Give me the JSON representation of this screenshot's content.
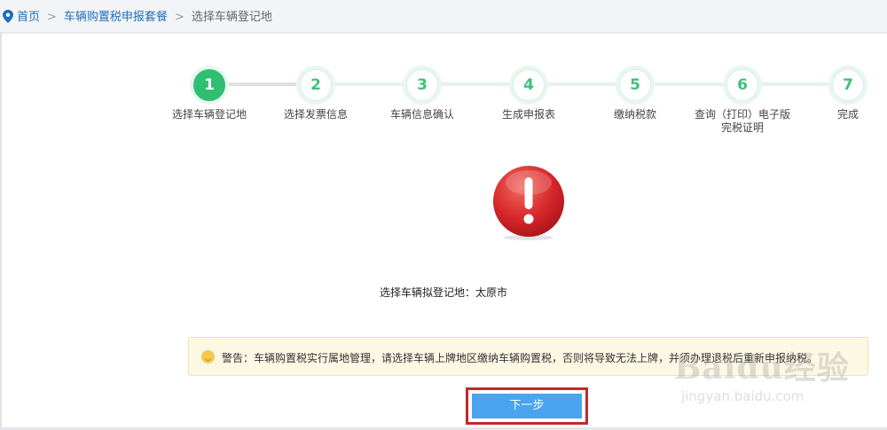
{
  "breadcrumb": {
    "home": "首页",
    "package": "车辆购置税申报套餐",
    "current": "选择车辆登记地"
  },
  "steps": [
    {
      "num": "1",
      "label": "选择车辆登记地",
      "active": true
    },
    {
      "num": "2",
      "label": "选择发票信息",
      "active": false
    },
    {
      "num": "3",
      "label": "车辆信息确认",
      "active": false
    },
    {
      "num": "4",
      "label": "生成申报表",
      "active": false
    },
    {
      "num": "5",
      "label": "缴纳税款",
      "active": false
    },
    {
      "num": "6",
      "label": "查询（打印）电子版\n完税证明",
      "active": false
    },
    {
      "num": "7",
      "label": "完成",
      "active": false
    }
  ],
  "region_text": "选择车辆拟登记地：太原市",
  "warning": {
    "text": "警告：车辆购置税实行属地管理，请选择车辆上牌地区缴纳车辆购置税，否则将导致无法上牌，并须办理退税后重新申报纳税。"
  },
  "next_button": "下一步",
  "watermark": {
    "line1": "Baidu经验",
    "line2": "jingyan.baidu.com"
  },
  "colors": {
    "accent_green": "#2fbf71",
    "button_blue": "#4aa4f0",
    "highlight_red": "#c0282d",
    "link_blue": "#1e6fb8"
  },
  "icons": [
    "location-pin-icon",
    "exclamation-alert-icon",
    "smile-warning-icon"
  ]
}
